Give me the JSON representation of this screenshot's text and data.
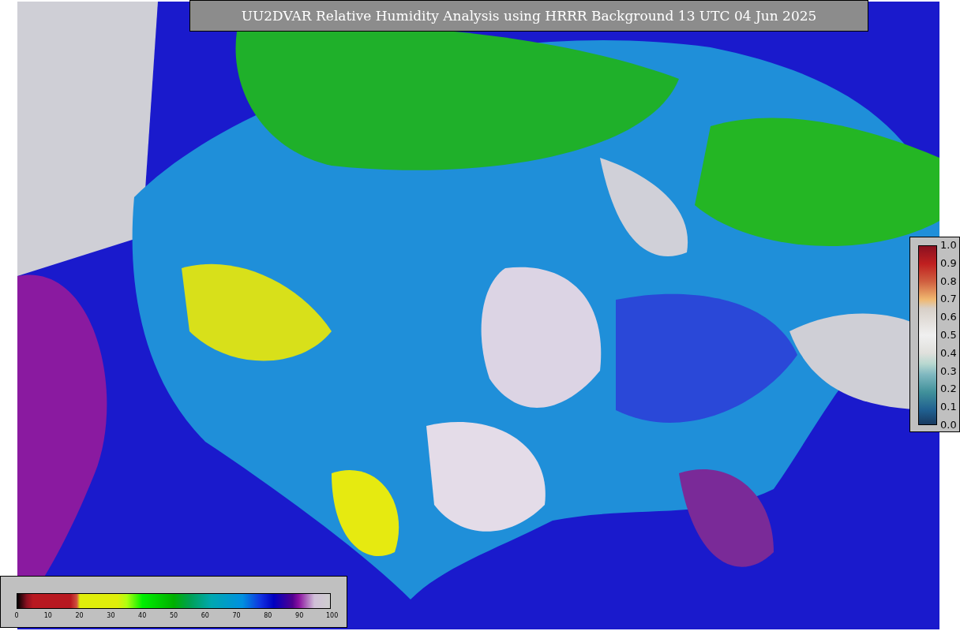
{
  "title": "UU2DVAR Relative Humidity Analysis using HRRR Background 13 UTC 04 Jun 2025",
  "humidity_colorbar": {
    "ticks": [
      "0",
      "10",
      "20",
      "30",
      "40",
      "50",
      "60",
      "70",
      "80",
      "90",
      "100"
    ]
  },
  "station_colorbar": {
    "ticks": [
      "1.0",
      "0.9",
      "0.8",
      "0.7",
      "0.6",
      "0.5",
      "0.4",
      "0.3",
      "0.2",
      "0.1",
      "0.0"
    ]
  }
}
